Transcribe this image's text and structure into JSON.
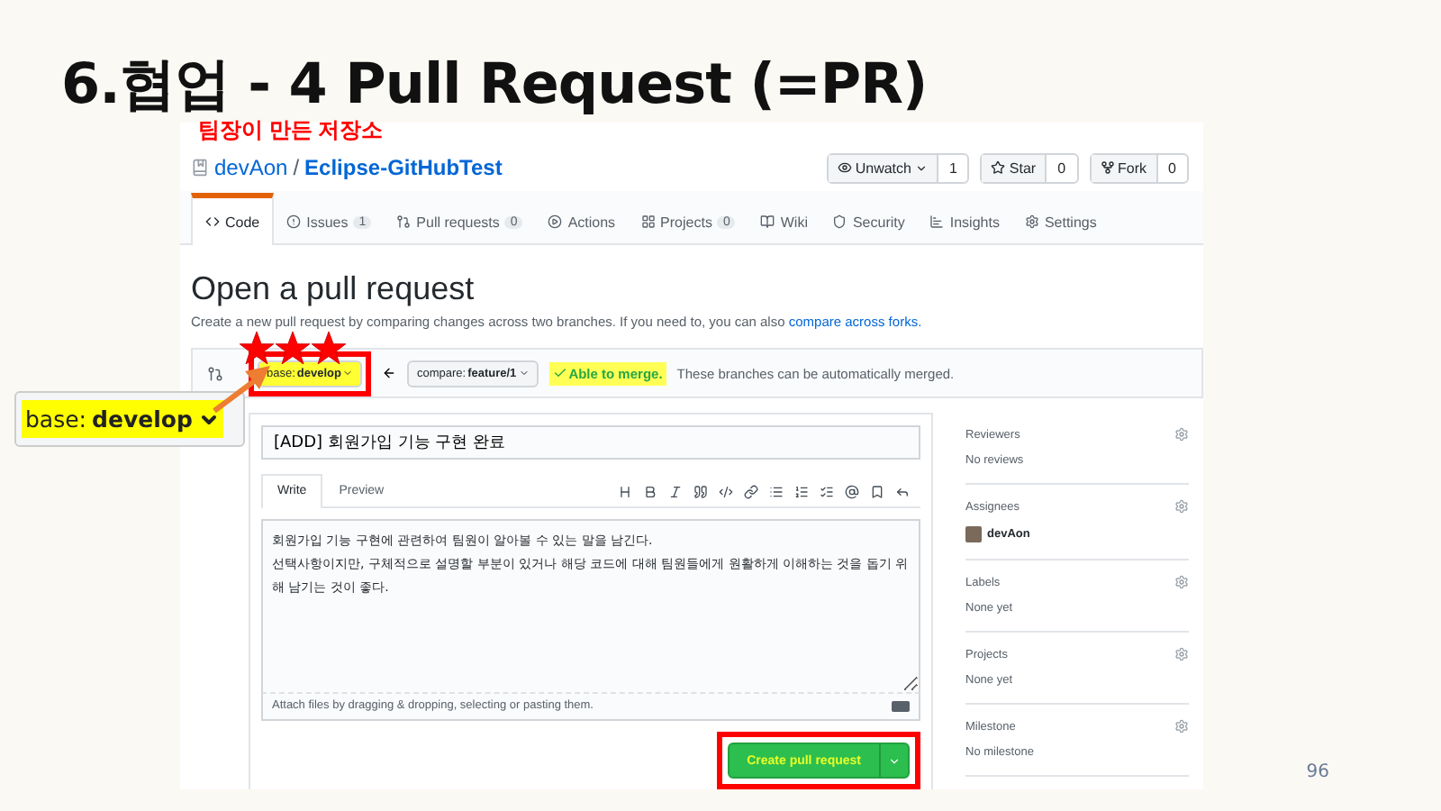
{
  "slide": {
    "title": "6.협업 - 4 Pull Request (=PR)",
    "page_number": "96"
  },
  "annotations": {
    "repo_note": "팀장이 만든 저장소",
    "stars": 3,
    "callout": {
      "label": "base: ",
      "branch": "develop"
    }
  },
  "repo": {
    "owner": "devAon",
    "separator": "/",
    "name": "Eclipse-GitHubTest"
  },
  "actions": [
    {
      "kind": "watch",
      "label": "Unwatch",
      "count": "1"
    },
    {
      "kind": "star",
      "label": "Star",
      "count": "0"
    },
    {
      "kind": "fork",
      "label": "Fork",
      "count": "0"
    }
  ],
  "tabs": [
    {
      "kind": "code",
      "label": "Code",
      "selected": true
    },
    {
      "kind": "issues",
      "label": "Issues",
      "count": "1",
      "selected": false
    },
    {
      "kind": "pulls",
      "label": "Pull requests",
      "count": "0",
      "selected": false
    },
    {
      "kind": "actions",
      "label": "Actions",
      "selected": false
    },
    {
      "kind": "projects",
      "label": "Projects",
      "count": "0",
      "selected": false
    },
    {
      "kind": "wiki",
      "label": "Wiki",
      "selected": false
    },
    {
      "kind": "security",
      "label": "Security",
      "selected": false
    },
    {
      "kind": "insights",
      "label": "Insights",
      "selected": false
    },
    {
      "kind": "settings",
      "label": "Settings",
      "selected": false
    }
  ],
  "page": {
    "heading": "Open a pull request",
    "description": "Create a new pull request by comparing changes across two branches. If you need to, you can also",
    "link": "compare across forks."
  },
  "branches": {
    "base_label": "base: ",
    "base": "develop",
    "compare_label": "compare: ",
    "compare": "feature/1",
    "merge_status": "Able to merge.",
    "merge_note": "These branches can be automatically merged."
  },
  "form": {
    "title": "[ADD] 회원가입 기능 구현 완료",
    "tabs": [
      {
        "label": "Write",
        "selected": true
      },
      {
        "label": "Preview",
        "selected": false
      }
    ],
    "body": "회원가입 기능 구현에 관련하여 팀원이 알아볼 수 있는 말을 남긴다.\n선택사항이지만, 구체적으로 설명할 부분이 있거나 해당 코드에 대해 팀원들에게 원활하게 이해하는 것을 돕기 위해 남기는 것이 좋다.",
    "attach_hint": "Attach files by dragging & dropping, selecting or pasting them.",
    "submit": "Create pull request"
  },
  "sidebar": [
    {
      "heading": "Reviewers",
      "value": "No reviews"
    },
    {
      "heading": "Assignees",
      "value": "devAon",
      "kind": "user"
    },
    {
      "heading": "Labels",
      "value": "None yet"
    },
    {
      "heading": "Projects",
      "value": "None yet"
    },
    {
      "heading": "Milestone",
      "value": "No milestone"
    }
  ]
}
